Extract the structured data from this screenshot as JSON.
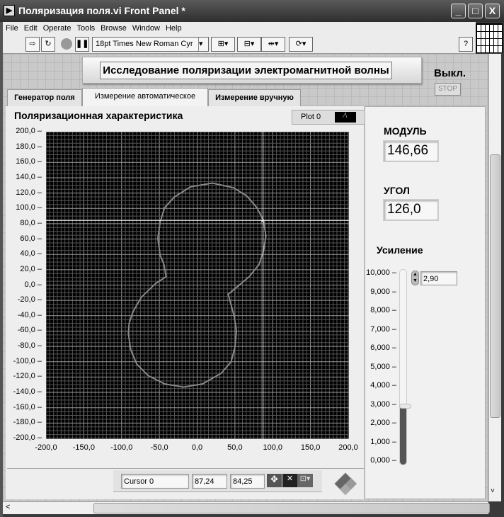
{
  "window": {
    "title": "Поляризация поля.vi Front Panel *",
    "minimize": "_",
    "maximize": "□",
    "close": "X"
  },
  "menu": [
    "File",
    "Edit",
    "Operate",
    "Tools",
    "Browse",
    "Window",
    "Help"
  ],
  "toolbar": {
    "font": "18pt Times New Roman Cyr",
    "help": "?"
  },
  "banner": "Исследование поляризации электромагнитной волны",
  "stop": {
    "label": "Выкл.",
    "button": "STOP"
  },
  "tabs": [
    {
      "label": "Генератор поля"
    },
    {
      "label": "Измерение автоматическое",
      "selected": true
    },
    {
      "label": "Измерение вручную"
    }
  ],
  "graph": {
    "title": "Поляризационная характеристика",
    "plot_legend": "Plot 0",
    "cursor": {
      "name": "Cursor 0",
      "x": "87,24",
      "y": "84,25"
    }
  },
  "modul": {
    "label": "МОДУЛЬ",
    "value": "146,66"
  },
  "ugol": {
    "label": "УГОЛ",
    "value": "126,0"
  },
  "gain": {
    "label": "Усиление",
    "value": "2,90",
    "fraction": 0.29,
    "ticks": [
      "10,000",
      "9,000",
      "8,000",
      "7,000",
      "6,000",
      "5,000",
      "4,000",
      "3,000",
      "2,000",
      "1,000",
      "0,000"
    ]
  },
  "chart_data": {
    "type": "line",
    "title": "Поляризационная характеристика",
    "xlim": [
      -200,
      200
    ],
    "ylim": [
      -200,
      200
    ],
    "grid": true,
    "xticks": [
      "-200,0",
      "-150,0",
      "-100,0",
      "-50,0",
      "0,0",
      "50,0",
      "100,0",
      "150,0",
      "200,0"
    ],
    "yticks": [
      "200,0",
      "180,0",
      "160,0",
      "140,0",
      "120,0",
      "100,0",
      "80,0",
      "60,0",
      "40,0",
      "20,0",
      "0,0",
      "-20,0",
      "-40,0",
      "-60,0",
      "-80,0",
      "-100,0",
      "-120,0",
      "-140,0",
      "-160,0",
      "-180,0",
      "-200,0"
    ],
    "cursor": [
      87.24,
      84.25
    ],
    "series": [
      {
        "name": "Plot 0",
        "points": [
          [
            20,
            133
          ],
          [
            -9,
            128
          ],
          [
            -30,
            115
          ],
          [
            -43,
            101
          ],
          [
            -49,
            82
          ],
          [
            -52,
            61
          ],
          [
            -49,
            39
          ],
          [
            -44,
            27
          ],
          [
            -41,
            11
          ],
          [
            -55,
            2
          ],
          [
            -74,
            -16
          ],
          [
            -85,
            -35
          ],
          [
            -90,
            -50
          ],
          [
            -91,
            -63
          ],
          [
            -88,
            -84
          ],
          [
            -80,
            -103
          ],
          [
            -65,
            -118
          ],
          [
            -43,
            -129
          ],
          [
            -18,
            -133
          ],
          [
            7,
            -129
          ],
          [
            32,
            -115
          ],
          [
            45,
            -100
          ],
          [
            50,
            -81
          ],
          [
            52,
            -59
          ],
          [
            49,
            -41
          ],
          [
            45,
            -26
          ],
          [
            41,
            -12
          ],
          [
            51,
            -4
          ],
          [
            69,
            11
          ],
          [
            82,
            27
          ],
          [
            88,
            45
          ],
          [
            91,
            64
          ],
          [
            88,
            84
          ],
          [
            79,
            101
          ],
          [
            66,
            116
          ],
          [
            48,
            127
          ],
          [
            20,
            133
          ]
        ]
      }
    ]
  }
}
